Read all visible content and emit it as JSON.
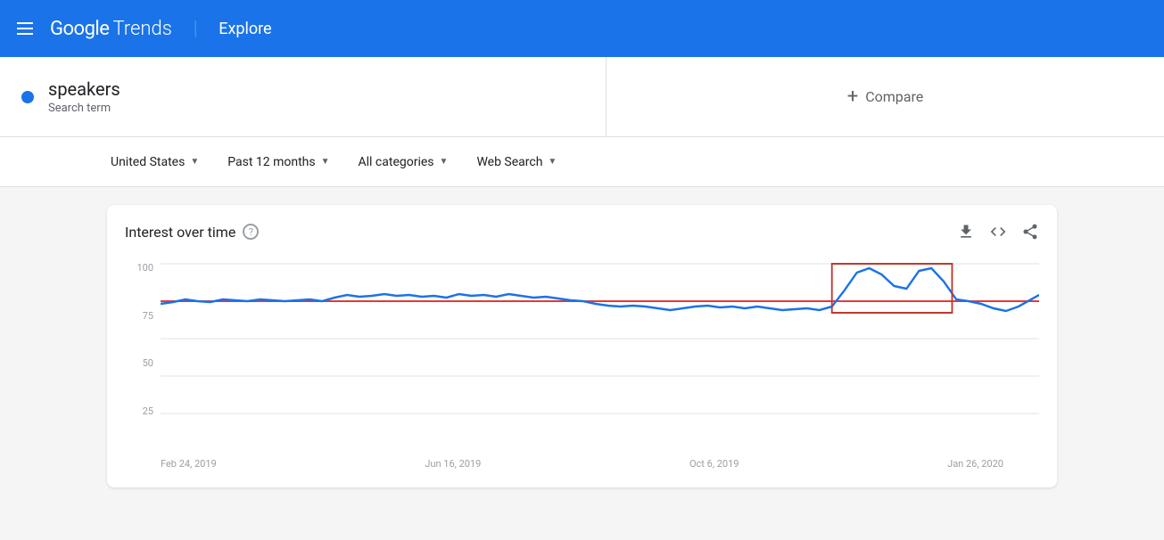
{
  "header": {
    "menu_label": "menu",
    "logo_google": "Google",
    "logo_trends": "Trends",
    "divider": "|",
    "explore_label": "Explore"
  },
  "search_term": {
    "term": "speakers",
    "type": "Search term",
    "compare_label": "Compare"
  },
  "filters": {
    "location": "United States",
    "time_range": "Past 12 months",
    "category": "All categories",
    "search_type": "Web Search"
  },
  "chart": {
    "title": "Interest over time",
    "help_label": "?",
    "y_axis": [
      "100",
      "75",
      "50",
      "25"
    ],
    "x_axis": [
      "Feb 24, 2019",
      "Jun 16, 2019",
      "Oct 6, 2019",
      "Jan 26, 2020"
    ],
    "actions": {
      "download": "download-icon",
      "embed": "embed-icon",
      "share": "share-icon"
    }
  }
}
